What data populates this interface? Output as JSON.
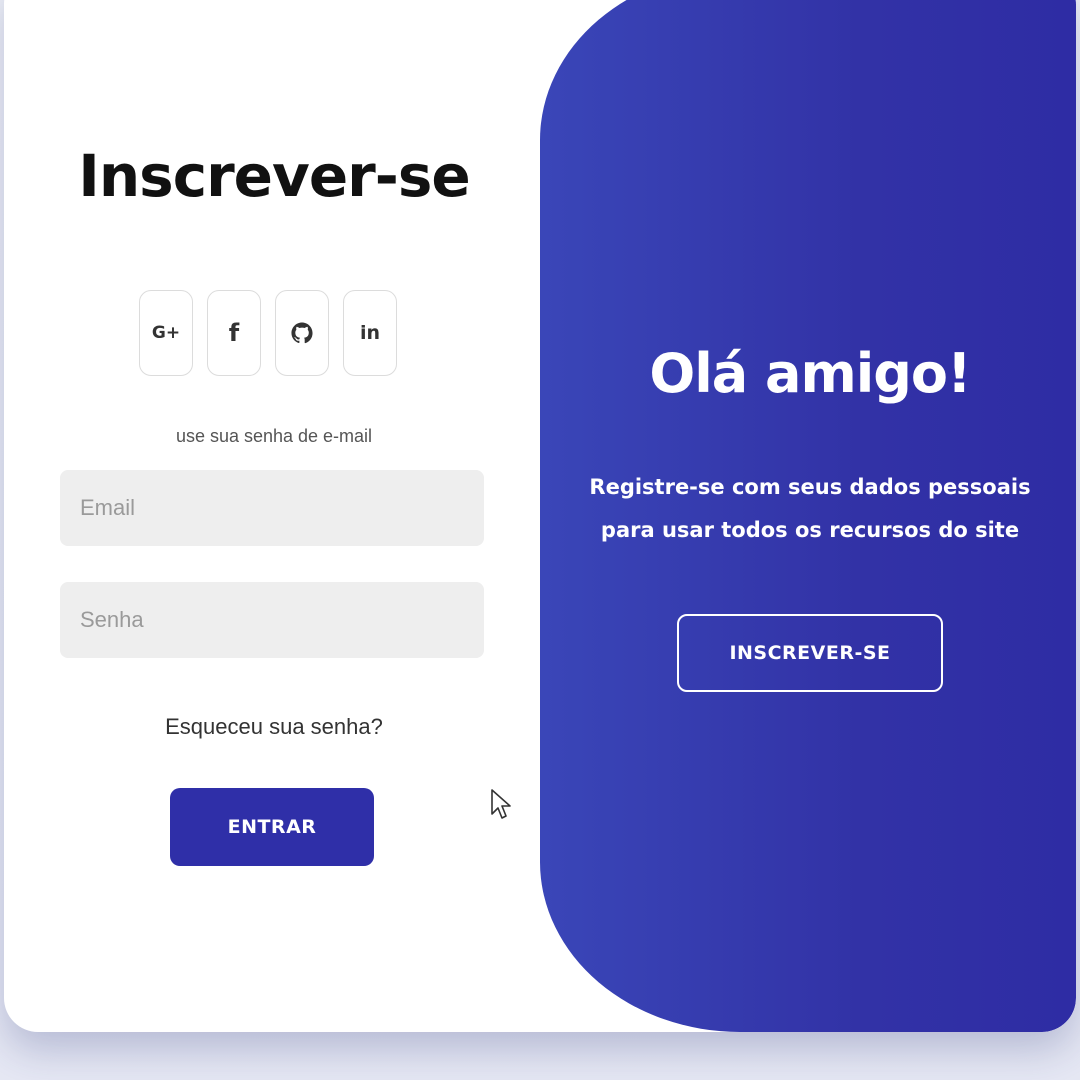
{
  "form": {
    "title": "Inscrever-se",
    "socials": [
      {
        "label": "G+",
        "icon": "google-plus-icon"
      },
      {
        "label": "f",
        "icon": "facebook-icon"
      },
      {
        "label": "",
        "icon": "github-icon"
      },
      {
        "label": "in",
        "icon": "linkedin-icon"
      }
    ],
    "hint": "use sua senha de e-mail",
    "email_placeholder": "Email",
    "email_value": "",
    "password_placeholder": "Senha",
    "password_value": "",
    "forgot_link": "Esqueceu sua senha?",
    "submit_label": "ENTRAR"
  },
  "overlay": {
    "title": "Olá amigo!",
    "text": "Registre-se com seus dados pessoais para usar todos os recursos do site",
    "button_label": "INSCREVER-SE"
  },
  "colors": {
    "accent": "#2f2fa8",
    "overlay_start": "#3a46b8",
    "overlay_end": "#2e2ca4",
    "field_bg": "#eeeeee"
  }
}
